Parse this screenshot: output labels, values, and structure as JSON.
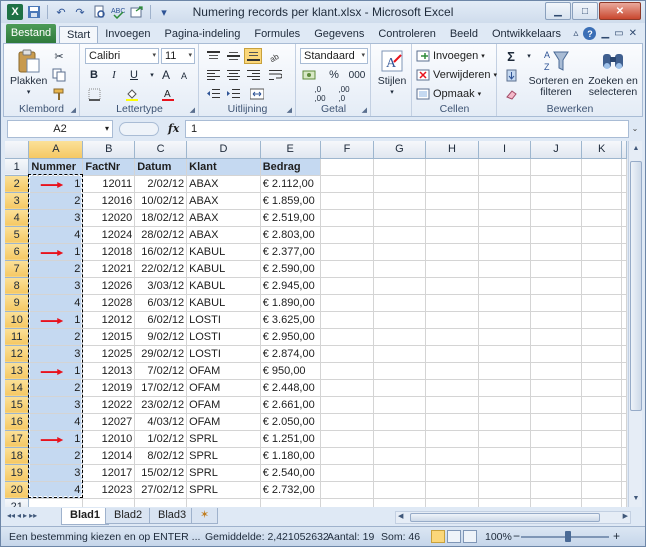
{
  "window": {
    "title": "Numering records per klant.xlsx - Microsoft Excel",
    "minimize": "▁",
    "maximize": "□",
    "close": "✕"
  },
  "quick_access": {
    "logo": "X",
    "save": "💾",
    "undo": "↶",
    "redo": "↷",
    "customize": "▾"
  },
  "ribbon_tabs": {
    "file": "Bestand",
    "tabs": [
      "Start",
      "Invoegen",
      "Pagina-indeling",
      "Formules",
      "Gegevens",
      "Controleren",
      "Beeld",
      "Ontwikkelaars"
    ],
    "active_tab": "Start"
  },
  "ribbon": {
    "clipboard": {
      "label": "Klembord",
      "paste": "Plakken"
    },
    "font": {
      "label": "Lettertype",
      "font_name": "Calibri",
      "font_size": "11",
      "bold": "B",
      "italic": "I",
      "underline": "U",
      "grow": "A",
      "shrink": "A"
    },
    "alignment": {
      "label": "Uitlijning"
    },
    "number": {
      "label": "Getal",
      "format": "Standaard",
      "percent": "%",
      "thousands": "000"
    },
    "styles": {
      "label": "Stijlen"
    },
    "cells": {
      "label": "Cellen",
      "insert": "Invoegen",
      "delete": "Verwijderen",
      "format": "Opmaak"
    },
    "editing": {
      "label": "Bewerken",
      "sort": "Sorteren en filteren",
      "find": "Zoeken en selecteren",
      "sum": "Σ"
    }
  },
  "formula_bar": {
    "name_box": "A2",
    "fx": "fx",
    "value": "1"
  },
  "grid": {
    "columns": [
      "A",
      "B",
      "C",
      "D",
      "E",
      "F",
      "G",
      "H",
      "I",
      "J",
      "K"
    ],
    "header_row": [
      "Nummer",
      "FactNr",
      "Datum",
      "Klant",
      "Bedrag"
    ],
    "rows": [
      [
        "1",
        "12011",
        "2/02/12",
        "ABAX",
        "€ 2.112,00"
      ],
      [
        "2",
        "12016",
        "10/02/12",
        "ABAX",
        "€ 1.859,00"
      ],
      [
        "3",
        "12020",
        "18/02/12",
        "ABAX",
        "€ 2.519,00"
      ],
      [
        "4",
        "12024",
        "28/02/12",
        "ABAX",
        "€ 2.803,00"
      ],
      [
        "1",
        "12018",
        "16/02/12",
        "KABUL",
        "€ 2.377,00"
      ],
      [
        "2",
        "12021",
        "22/02/12",
        "KABUL",
        "€ 2.590,00"
      ],
      [
        "3",
        "12026",
        "3/03/12",
        "KABUL",
        "€ 2.945,00"
      ],
      [
        "4",
        "12028",
        "6/03/12",
        "KABUL",
        "€ 1.890,00"
      ],
      [
        "1",
        "12012",
        "6/02/12",
        "LOSTI",
        "€ 3.625,00"
      ],
      [
        "2",
        "12015",
        "9/02/12",
        "LOSTI",
        "€ 2.950,00"
      ],
      [
        "3",
        "12025",
        "29/02/12",
        "LOSTI",
        "€ 2.874,00"
      ],
      [
        "1",
        "12013",
        "7/02/12",
        "OFAM",
        "€    950,00"
      ],
      [
        "2",
        "12019",
        "17/02/12",
        "OFAM",
        "€ 2.448,00"
      ],
      [
        "3",
        "12022",
        "23/02/12",
        "OFAM",
        "€ 2.661,00"
      ],
      [
        "4",
        "12027",
        "4/03/12",
        "OFAM",
        "€ 2.050,00"
      ],
      [
        "1",
        "12010",
        "1/02/12",
        "SPRL",
        "€ 1.251,00"
      ],
      [
        "2",
        "12014",
        "8/02/12",
        "SPRL",
        "€ 1.180,00"
      ],
      [
        "3",
        "12017",
        "15/02/12",
        "SPRL",
        "€ 2.540,00"
      ],
      [
        "4",
        "12023",
        "27/02/12",
        "SPRL",
        "€ 2.732,00"
      ],
      [
        "",
        "",
        "",
        "",
        ""
      ]
    ],
    "arrow_rows": [
      2,
      6,
      10,
      13,
      17
    ],
    "arrow_color": "#e8121c",
    "selection_color": "#c5d9f1"
  },
  "sheet_tabs": {
    "tabs": [
      "Blad1",
      "Blad2",
      "Blad3"
    ],
    "active": "Blad1",
    "new_sheet": "✶"
  },
  "status_bar": {
    "message": "Een bestemming kiezen en op ENTER ...",
    "average": "Gemiddelde: 2,421052632",
    "count": "Aantal: 19",
    "sum": "Som: 46",
    "zoom": "100%",
    "zoom_minus": "−",
    "zoom_plus": "+"
  }
}
